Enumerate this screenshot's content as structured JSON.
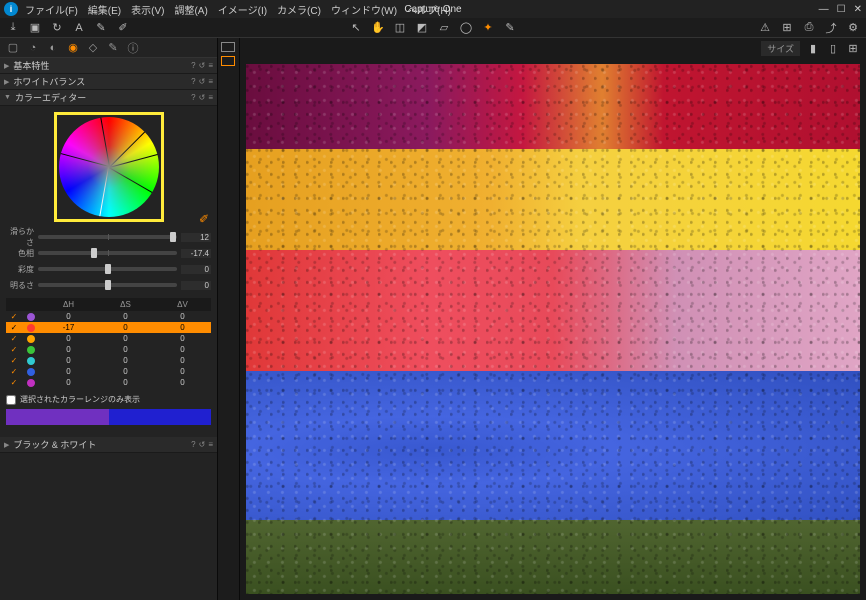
{
  "app": {
    "title": "Capture One"
  },
  "menu": [
    "ファイル(F)",
    "編集(E)",
    "表示(V)",
    "調整(A)",
    "イメージ(I)",
    "カメラ(C)",
    "ウィンドウ(W)",
    "ヘルプ(H)"
  ],
  "panels": {
    "basic": {
      "label": "基本特性"
    },
    "wb": {
      "label": "ホワイトバランス"
    },
    "color_editor": {
      "label": "カラーエディター"
    },
    "bw": {
      "label": "ブラック & ホワイト"
    }
  },
  "sliders": [
    {
      "label": "滑らかさ",
      "value": "12",
      "pos": 95
    },
    {
      "label": "色相",
      "value": "-17.4",
      "pos": 38
    },
    {
      "label": "彩度",
      "value": "0",
      "pos": 48
    },
    {
      "label": "明るさ",
      "value": "0",
      "pos": 48
    }
  ],
  "table": {
    "headers": [
      "ΔH",
      "ΔS",
      "ΔV"
    ],
    "rows": [
      {
        "checked": true,
        "color": "#9b55d4",
        "dh": "0",
        "ds": "0",
        "dv": "0",
        "active": false
      },
      {
        "checked": true,
        "color": "#ff3b30",
        "dh": "-17",
        "ds": "0",
        "dv": "0",
        "active": true
      },
      {
        "checked": true,
        "color": "#ffa500",
        "dh": "0",
        "ds": "0",
        "dv": "0",
        "active": false
      },
      {
        "checked": true,
        "color": "#3ac43a",
        "dh": "0",
        "ds": "0",
        "dv": "0",
        "active": false
      },
      {
        "checked": true,
        "color": "#30c9d0",
        "dh": "0",
        "ds": "0",
        "dv": "0",
        "active": false
      },
      {
        "checked": true,
        "color": "#3060e0",
        "dh": "0",
        "ds": "0",
        "dv": "0",
        "active": false
      },
      {
        "checked": true,
        "color": "#c030c0",
        "dh": "0",
        "ds": "0",
        "dv": "0",
        "active": false
      }
    ]
  },
  "advanced": {
    "show_selected_only": "選択されたカラーレンジのみ表示",
    "grad": [
      "#7030c0",
      "#2020d0"
    ]
  },
  "viewer": {
    "size_label": "サイズ"
  }
}
